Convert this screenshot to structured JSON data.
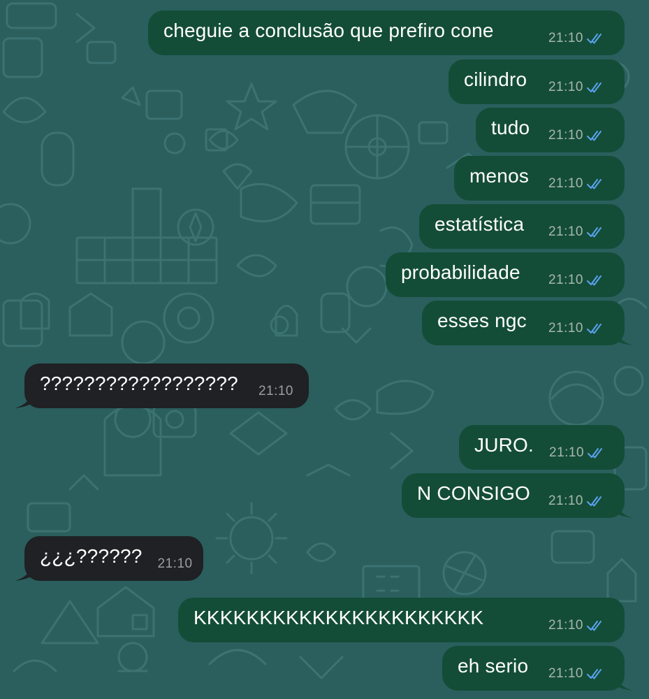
{
  "colors": {
    "wallpaper": "#2a5f5e",
    "outgoing_bubble": "#144d37",
    "incoming_bubble": "#1f2124",
    "read_ticks": "#5aa3f0"
  },
  "messages": [
    {
      "direction": "out",
      "text": "cheguie a conclusão que prefiro cone",
      "time": "21:10",
      "status": "read"
    },
    {
      "direction": "out",
      "text": "cilindro",
      "time": "21:10",
      "status": "read"
    },
    {
      "direction": "out",
      "text": "tudo",
      "time": "21:10",
      "status": "read"
    },
    {
      "direction": "out",
      "text": "menos",
      "time": "21:10",
      "status": "read"
    },
    {
      "direction": "out",
      "text": "estatística",
      "time": "21:10",
      "status": "read"
    },
    {
      "direction": "out",
      "text": "probabilidade",
      "time": "21:10",
      "status": "read"
    },
    {
      "direction": "out",
      "text": "esses ngc",
      "time": "21:10",
      "status": "read"
    },
    {
      "direction": "in",
      "text": "??????????????????",
      "time": "21:10"
    },
    {
      "direction": "out",
      "text": "JURO.",
      "time": "21:10",
      "status": "read"
    },
    {
      "direction": "out",
      "text": "N CONSIGO",
      "time": "21:10",
      "status": "read"
    },
    {
      "direction": "in",
      "text": "¿¿¿??????",
      "time": "21:10"
    },
    {
      "direction": "out",
      "text": "KKKKKKKKKKKKKKKKKKKKKK",
      "time": "21:10",
      "status": "read"
    },
    {
      "direction": "out",
      "text": "eh serio",
      "time": "21:10",
      "status": "read"
    }
  ]
}
